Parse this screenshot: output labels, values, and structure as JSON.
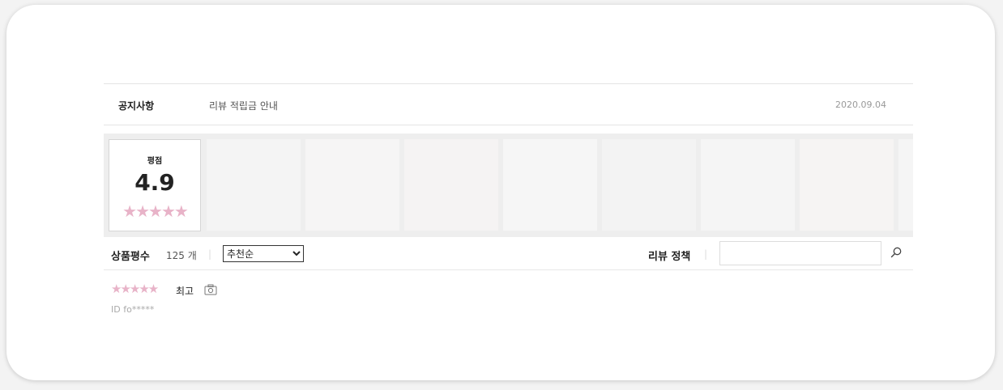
{
  "notice": {
    "label": "공지사항",
    "title": "리뷰 적립금 안내",
    "date": "2020.09.04"
  },
  "rating": {
    "label": "평점",
    "score": "4.9",
    "stars": "★★★★★",
    "star_color": "#e8b3c8"
  },
  "gallery": {
    "thumb_colors": [
      "#f4f4f4",
      "#f6f5f5",
      "#f5f3f3",
      "#f6f6f6",
      "#f3f3f3",
      "#f5f5f5",
      "#f6f4f3",
      "#f5f5f5"
    ]
  },
  "filter": {
    "count_label": "상품평수",
    "count_value": "125 개",
    "sort_options": [
      "추천순"
    ],
    "sort_selected": "추천순",
    "policy_label": "리뷰 정책",
    "search_placeholder": ""
  },
  "review": {
    "stars": "★★★★★",
    "headline": "최고",
    "reviewer": "ID fo*****"
  }
}
